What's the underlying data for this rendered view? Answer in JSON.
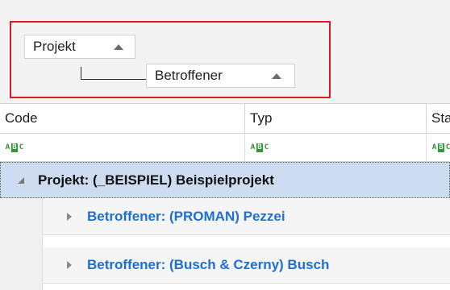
{
  "group_panel": {
    "chips": [
      {
        "label": "Projekt"
      },
      {
        "label": "Betroffener"
      }
    ],
    "highlight_color": "#e01a24"
  },
  "columns": [
    {
      "label": "Code"
    },
    {
      "label": "Typ"
    },
    {
      "label": "Sta"
    }
  ],
  "filter_icon": {
    "a": "A",
    "b": "B",
    "c": "C"
  },
  "groups": {
    "level1": {
      "label": "Projekt: (_BEISPIEL) Beispielprojekt"
    },
    "level2": [
      {
        "label": "Betroffener: (PROMAN) Pezzei"
      },
      {
        "label": "Betroffener: (Busch & Czerny) Busch"
      }
    ]
  },
  "colors": {
    "group_row_bg": "#cddcf0",
    "link_text": "#1c6fd6",
    "filter_icon_green": "#2f9a2f"
  }
}
